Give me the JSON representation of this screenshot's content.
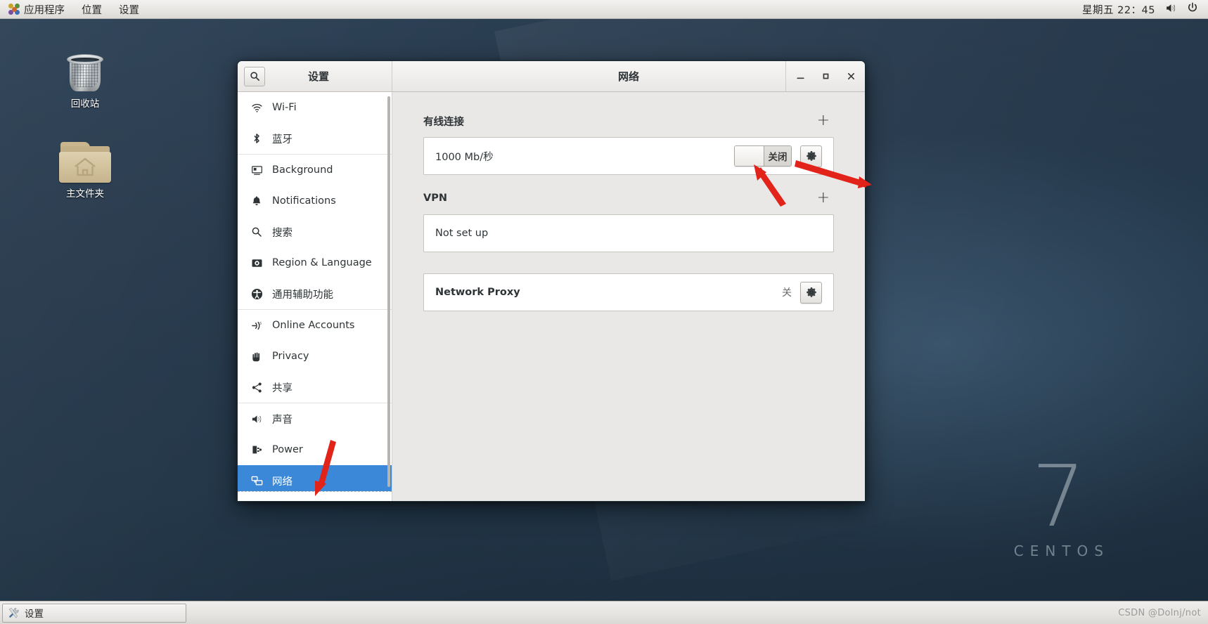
{
  "top_panel": {
    "apps_icon": "applications-icon",
    "menus": [
      "应用程序",
      "位置",
      "设置"
    ],
    "clock": "星期五 22：45",
    "volume_icon": "volume-icon",
    "power_icon": "power-icon"
  },
  "desktop": {
    "icons": [
      {
        "name": "trash",
        "label": "回收站"
      },
      {
        "name": "home-folder",
        "label": "主文件夹"
      }
    ],
    "watermark": {
      "number": "7",
      "word": "CENTOS"
    }
  },
  "window": {
    "search_icon": "search-icon",
    "left_title": "设置",
    "right_title": "网络",
    "controls": {
      "minimize": "–",
      "maximize": "▫",
      "close": "✕"
    }
  },
  "sidebar": {
    "items": [
      {
        "label": "Wi-Fi",
        "icon": "wifi-icon",
        "selected": false
      },
      {
        "label": "蓝牙",
        "icon": "bluetooth-icon",
        "selected": false
      },
      {
        "label": "Background",
        "icon": "background-icon",
        "selected": false
      },
      {
        "label": "Notifications",
        "icon": "bell-icon",
        "selected": false
      },
      {
        "label": "搜索",
        "icon": "search-icon",
        "selected": false
      },
      {
        "label": "Region & Language",
        "icon": "region-language-icon",
        "selected": false
      },
      {
        "label": "通用辅助功能",
        "icon": "accessibility-icon",
        "selected": false
      },
      {
        "label": "Online Accounts",
        "icon": "online-accounts-icon",
        "selected": false
      },
      {
        "label": "Privacy",
        "icon": "privacy-hand-icon",
        "selected": false
      },
      {
        "label": "共享",
        "icon": "sharing-icon",
        "selected": false
      },
      {
        "label": "声音",
        "icon": "sound-icon",
        "selected": false
      },
      {
        "label": "Power",
        "icon": "power-plug-icon",
        "selected": false
      },
      {
        "label": "网络",
        "icon": "network-icon",
        "selected": true
      }
    ]
  },
  "content": {
    "wired": {
      "title": "有线连接",
      "add_label": "+",
      "speed": "1000 Mb/秒",
      "toggle_state": "关闭",
      "settings_icon": "gear-icon"
    },
    "vpn": {
      "title": "VPN",
      "add_label": "+",
      "status": "Not set up"
    },
    "proxy": {
      "title": "Network Proxy",
      "status": "关",
      "settings_icon": "gear-icon"
    }
  },
  "taskbar": {
    "window_button": {
      "label": "设置",
      "icon": "tools-icon"
    },
    "watermark": "CSDN @Dolnj/not"
  },
  "colors": {
    "accent": "#3b88d8",
    "panel_bg": "#e8e6e3",
    "content_bg": "#e9e8e6",
    "arrow_red": "#e2231a"
  }
}
